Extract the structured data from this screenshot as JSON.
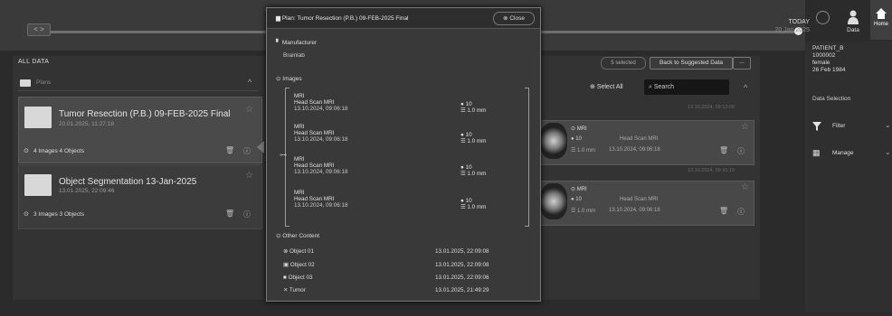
{
  "header": {
    "back_label": "< >",
    "today_label": "TODAY",
    "today_date": "20 Jan 2025",
    "data_tab": "Data",
    "home_tab": "Home"
  },
  "left": {
    "all_data": "ALL DATA",
    "plans_label": "Plans",
    "cards": [
      {
        "title": "Tumor Resection (P.B.) 09-FEB-2025 Final",
        "date": "20.01.2025, 11:27:18",
        "meta": "4 Images  4 Objects"
      },
      {
        "title": "Object Segmentation 13-Jan-2025",
        "date": "13.01.2025, 22:09:46",
        "meta": "3 Images  3 Objects"
      }
    ]
  },
  "popup": {
    "title": "Plan: Tumor Resection (P.B.) 09-FEB-2025 Final",
    "close": "Close",
    "manufacturer_label": "Manufacturer",
    "manufacturer_value": "Brainlab",
    "images_label": "Images",
    "images": [
      {
        "modality": "MRI",
        "name": "Head Scan MRI",
        "date": "13.10.2024, 09:06:18",
        "count": "10",
        "thickness": "1.0 mm"
      },
      {
        "modality": "MRI",
        "name": "Head Scan MRI",
        "date": "13.10.2024, 09:06:18",
        "count": "10",
        "thickness": "1.0 mm"
      },
      {
        "modality": "MRI",
        "name": "Head Scan MRI",
        "date": "13.10.2024, 09:06:18",
        "count": "10",
        "thickness": "1.0 mm"
      },
      {
        "modality": "MRI",
        "name": "Head Scan MRI",
        "date": "13.10.2024, 09:06:18",
        "count": "10",
        "thickness": "1.0 mm"
      }
    ],
    "other_content_label": "Other Content",
    "objects": [
      {
        "name": "Object 01",
        "date": "13.01.2025, 22:09:08"
      },
      {
        "name": "Object 02",
        "date": "13.01.2025, 22:09:08"
      },
      {
        "name": "Object 03",
        "date": "13.01.2025, 22:09:06"
      },
      {
        "name": "Tumor",
        "date": "13.01.2025, 21:49:29"
      }
    ]
  },
  "middle": {
    "selected": "5 selected",
    "back_suggested": "Back to Suggested Data",
    "more": "...",
    "select_all": "Select All",
    "search_placeholder": "Search",
    "timestamp1": "13.10.2024, 09:13:00",
    "timestamp2": "13.10.2024, 09:15:19",
    "series": [
      {
        "modality": "MRI",
        "count": "10",
        "name": "Head Scan MRI",
        "thickness": "1.0 mm",
        "date": "13.10.2024, 09:06:18"
      },
      {
        "modality": "MRI",
        "count": "10",
        "name": "Head Scan MRI",
        "thickness": "1.0 mm",
        "date": "13.10.2024, 09:06:18"
      }
    ]
  },
  "patient": {
    "name": "PATIENT_B",
    "id": "1000002",
    "sex": "female",
    "dob": "26 Feb 1984"
  },
  "sidebar": {
    "data_selection": "Data Selection",
    "filter": "Filter",
    "manage": "Manage"
  }
}
